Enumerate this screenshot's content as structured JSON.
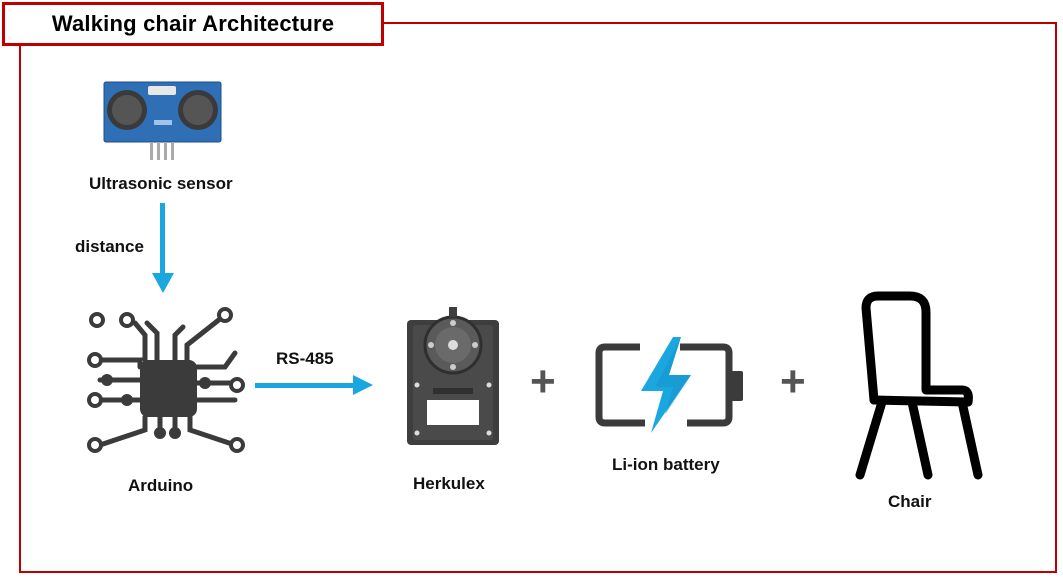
{
  "title": "Walking chair Architecture",
  "nodes": {
    "sensor": "Ultrasonic sensor",
    "arduino": "Arduino",
    "herkulex": "Herkulex",
    "battery": "Li-ion battery",
    "chair": "Chair"
  },
  "edges": {
    "distance": "distance",
    "rs485": "RS-485"
  },
  "operators": {
    "plus1": "+",
    "plus2": "+"
  },
  "colors": {
    "frame": "#c00000",
    "arrow": "#1aa7e0",
    "icon_dark": "#3b3b3b",
    "sensor_blue": "#2f6fb5"
  }
}
